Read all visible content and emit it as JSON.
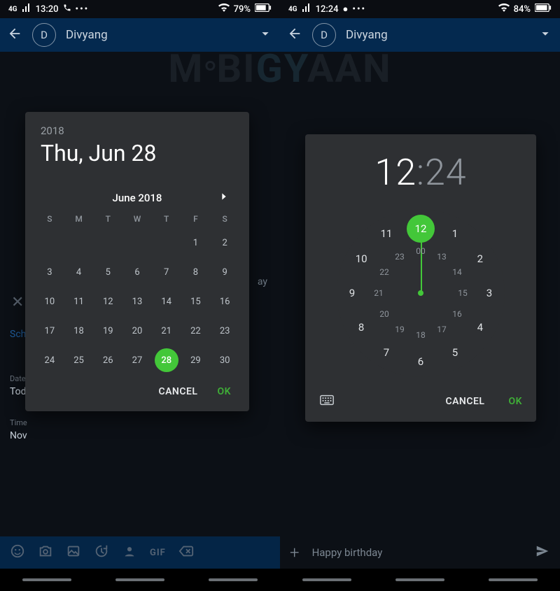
{
  "watermark": {
    "pre": "M",
    "mid": "BI",
    "gy": "GY",
    "post": "AAN"
  },
  "left": {
    "status": {
      "net": "4G",
      "time": "13:20",
      "batt_pct": "79%"
    },
    "header": {
      "avatar_initial": "D",
      "name": "Divyang"
    },
    "bg": {
      "x": "✕",
      "sch": "Sch",
      "date_lbl": "Date",
      "date_val": "Tod",
      "time_lbl": "Time",
      "time_val": "Nov",
      "ay": "ay"
    },
    "date_picker": {
      "year": "2018",
      "date_long": "Thu, Jun 28",
      "month_label": "June 2018",
      "dow": [
        "S",
        "M",
        "T",
        "W",
        "T",
        "F",
        "S"
      ],
      "leading_blanks": 5,
      "days": [
        1,
        2,
        3,
        4,
        5,
        6,
        7,
        8,
        9,
        10,
        11,
        12,
        13,
        14,
        15,
        16,
        17,
        18,
        19,
        20,
        21,
        22,
        23,
        24,
        25,
        26,
        27,
        28,
        29,
        30
      ],
      "selected": 28,
      "cancel": "CANCEL",
      "ok": "OK"
    },
    "input_icons": {
      "gif": "GIF"
    }
  },
  "right": {
    "status": {
      "net": "4G",
      "time": "12:24",
      "batt_pct": "84%"
    },
    "header": {
      "avatar_initial": "D",
      "name": "Divyang"
    },
    "time_picker": {
      "hh": "12",
      "mm": "24",
      "outer_hours": [
        12,
        1,
        2,
        3,
        4,
        5,
        6,
        7,
        8,
        9,
        10,
        11
      ],
      "inner_hours": [
        "00",
        "13",
        "14",
        "15",
        "16",
        "17",
        "18",
        "19",
        "20",
        "21",
        "22",
        "23"
      ],
      "cancel": "CANCEL",
      "ok": "OK"
    },
    "compose": {
      "placeholder": "Happy birthday"
    }
  }
}
